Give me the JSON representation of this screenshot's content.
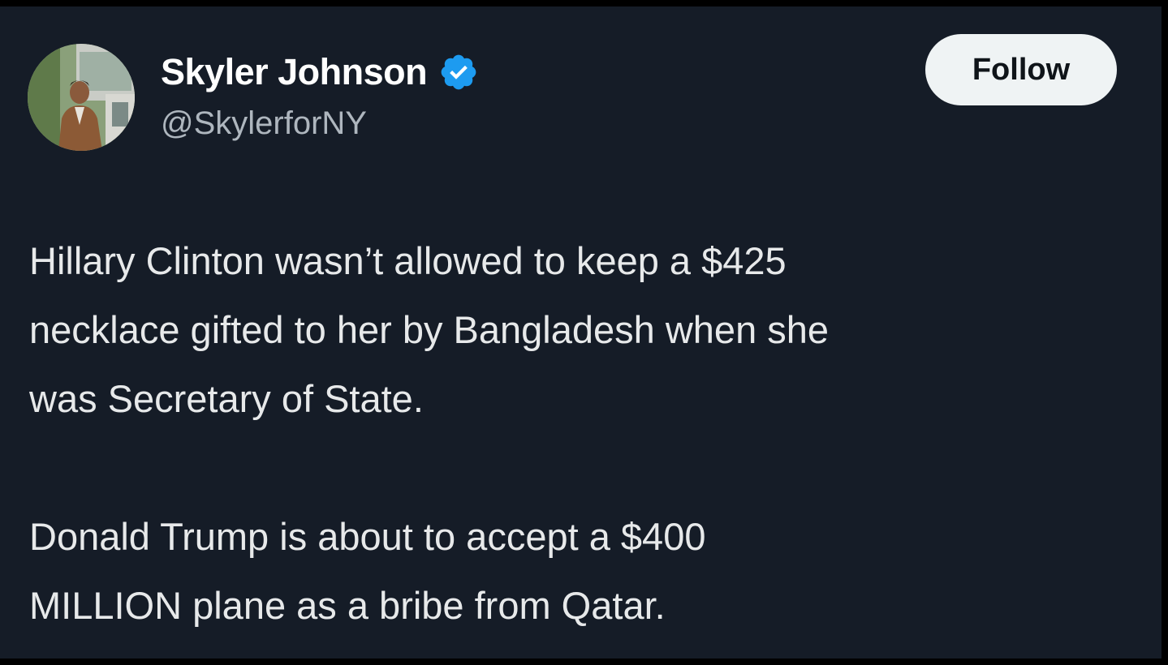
{
  "tweet": {
    "author": {
      "display_name": "Skyler Johnson",
      "handle": "@SkylerforNY",
      "verified": true,
      "verified_icon": "verified-badge-icon",
      "avatar": "profile photo"
    },
    "follow_label": "Follow",
    "paragraphs": [
      {
        "lines": [
          "Hillary Clinton wasn’t allowed to keep a $425",
          "necklace gifted to her by Bangladesh when she",
          "was Secretary of State."
        ]
      },
      {
        "lines": [
          "Donald Trump is about to accept a $400",
          "MILLION plane as a bribe from Qatar."
        ]
      }
    ]
  },
  "colors": {
    "background": "#151c27",
    "text_primary": "#e7e9ea",
    "text_secondary": "#aeb6be",
    "verified_blue": "#1d9bf0",
    "follow_button_bg": "#eff3f4",
    "follow_button_text": "#0f1419"
  }
}
